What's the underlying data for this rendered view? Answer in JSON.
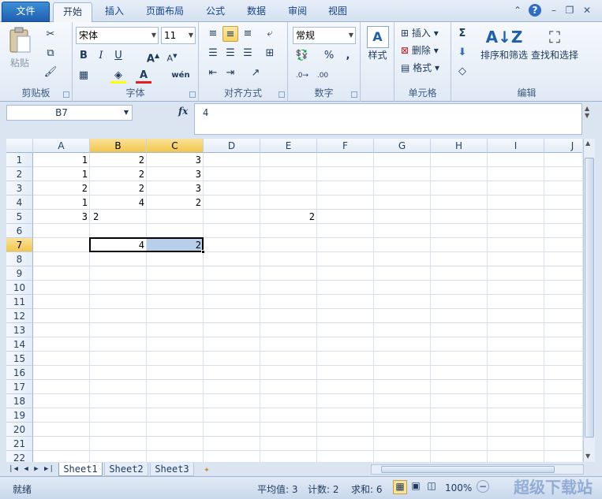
{
  "tabs": {
    "file": "文件",
    "home": "开始",
    "insert": "插入",
    "layout": "页面布局",
    "formulas": "公式",
    "data": "数据",
    "review": "审阅",
    "view": "视图"
  },
  "ribbon": {
    "clipboard": {
      "paste": "粘贴",
      "label": "剪贴板"
    },
    "font": {
      "name": "宋体",
      "size": "11",
      "label": "字体",
      "bold": "B",
      "italic": "I",
      "underline": "U",
      "wen": "wén"
    },
    "alignment": {
      "label": "对齐方式"
    },
    "number": {
      "format": "常规",
      "label": "数字",
      "percent": "%",
      "comma": ","
    },
    "styles": {
      "label": "样式"
    },
    "cells": {
      "insert": "插入",
      "delete": "删除",
      "format": "格式",
      "label": "单元格"
    },
    "editing": {
      "sortfilter": "排序和筛选",
      "findselect": "查找和选择",
      "label": "编辑"
    }
  },
  "formula_bar": {
    "namebox": "B7",
    "fx": "fx",
    "content": "4"
  },
  "columns": [
    "A",
    "B",
    "C",
    "D",
    "E",
    "F",
    "G",
    "H",
    "I",
    "J"
  ],
  "rows": [
    "1",
    "2",
    "3",
    "4",
    "5",
    "6",
    "7",
    "8",
    "9",
    "10",
    "11",
    "12",
    "13",
    "14",
    "15",
    "16",
    "17",
    "18",
    "19",
    "20",
    "21",
    "22"
  ],
  "cells": {
    "A1": "1",
    "B1": "2",
    "C1": "3",
    "A2": "1",
    "B2": "2",
    "C2": "3",
    "A3": "2",
    "B3": "2",
    "C3": "3",
    "A4": "1",
    "B4": "4",
    "C4": "2",
    "A5": "3",
    "B5": "2",
    "E5": "2",
    "B7": "4",
    "C7": "2"
  },
  "sheets": [
    "Sheet1",
    "Sheet2",
    "Sheet3"
  ],
  "status": {
    "ready": "就绪",
    "average": "平均值: 3",
    "count": "计数: 2",
    "sum": "求和: 6",
    "zoom": "100%"
  },
  "watermark": "超级下载站",
  "colors": {
    "accent": "#f2c64c",
    "file_tab": "#1f5fb0",
    "selection": "#b8cfec"
  }
}
